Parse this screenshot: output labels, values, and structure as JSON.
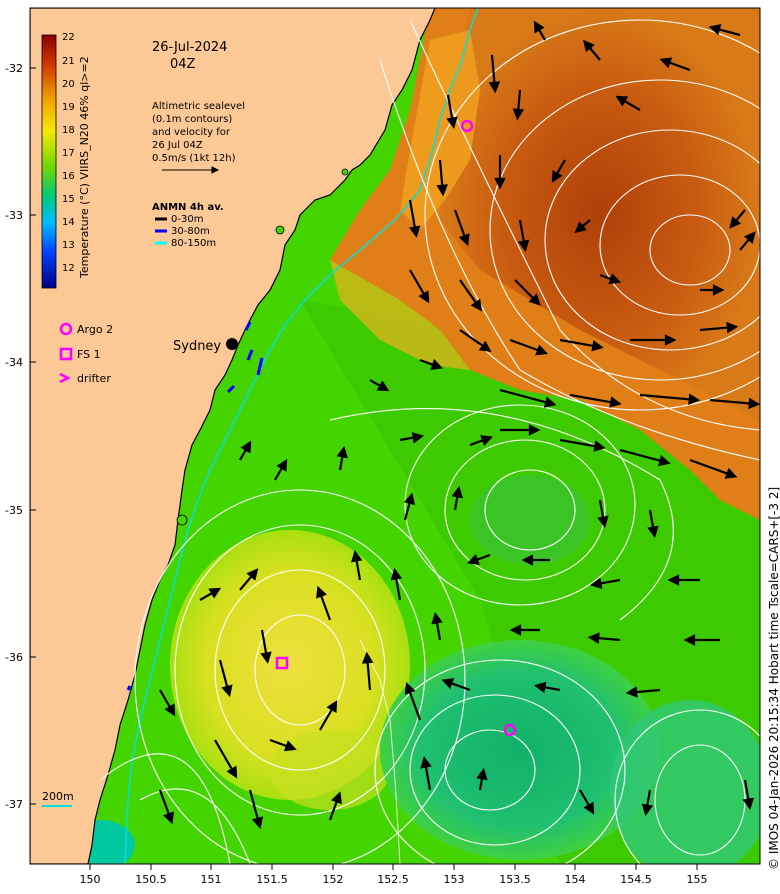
{
  "date": "26-Jul-2024",
  "time": "04Z",
  "description": {
    "line1": "Altimetric sealevel",
    "line2": "(0.1m contours)",
    "line3": "and velocity for",
    "line4": "26 Jul 04Z",
    "line5": "0.5m/s (1kt 12h)"
  },
  "anmn": {
    "title": "ANMN 4h av.",
    "items": [
      {
        "label": "0-30m",
        "color": "#000000"
      },
      {
        "label": "30-80m",
        "color": "#0000ff"
      },
      {
        "label": "80-150m",
        "color": "#00ffff"
      }
    ]
  },
  "colorbar": {
    "label": "Temperature (°C) VIIRS_N20 46% ql>=2",
    "ticks": [
      "22",
      "21",
      "20",
      "19",
      "18",
      "17",
      "16",
      "15",
      "14",
      "13",
      "12"
    ],
    "colors": [
      "#8b0000",
      "#c03000",
      "#e06000",
      "#f0a000",
      "#f5e000",
      "#b0e000",
      "#30d000",
      "#00c890",
      "#00a8ff",
      "#0040ff",
      "#000080"
    ]
  },
  "legend": {
    "argo": "Argo 2",
    "fs": "FS 1",
    "drifter": "drifter",
    "marker_color": "#ff00ff"
  },
  "place": {
    "sydney": "Sydney"
  },
  "depth_label": "200m",
  "lon_ticks": [
    "150",
    "150.5",
    "151",
    "151.5",
    "152",
    "152.5",
    "153",
    "153.5",
    "154",
    "154.5",
    "155"
  ],
  "lat_ticks": [
    "-32",
    "-33",
    "-34",
    "-35",
    "-36",
    "-37"
  ],
  "credit": "© IMOS 04-Jan-2026 20:15:34 Hobart time Tscale=CARS+[-3 2]",
  "colors": {
    "land": "#fbc896",
    "warm_eac": "#c85a10",
    "coastal": "#44d400",
    "warm_shelf": "#e8e030",
    "cool_eddy": "#20c070",
    "contour": "#ffffff",
    "isobath": "#00e0e0"
  }
}
